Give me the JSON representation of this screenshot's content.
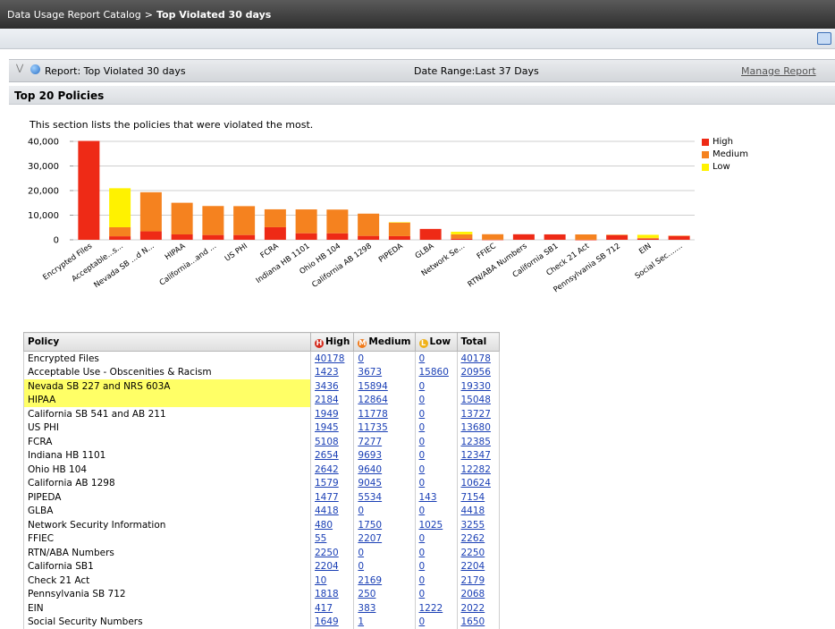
{
  "breadcrumb": {
    "root": "Data Usage Report Catalog",
    "separator": ">",
    "current": "Top Violated 30 days"
  },
  "report_header": {
    "title": "Report: Top Violated 30 days",
    "date_range": "Date Range:Last 37 Days",
    "manage_label": "Manage Report"
  },
  "section": {
    "title": "Top 20 Policies",
    "description": "This section lists the policies that were violated the most."
  },
  "colors": {
    "high": "#ee2a16",
    "medium": "#f5821f",
    "low": "#fff200"
  },
  "chart_data": {
    "type": "bar",
    "stacked": true,
    "categories": [
      "Encrypted Files",
      "Acceptable...s...",
      "Nevada SB ...d N...",
      "HIPAA",
      "California...and ...",
      "US PHI",
      "FCRA",
      "Indiana HB 1101",
      "Ohio HB 104",
      "California AB 1298",
      "PIPEDA",
      "GLBA",
      "Network Se...",
      "FFIEC",
      "RTN/ABA Numbers",
      "California SB1",
      "Check 21 Act",
      "Pennsylvania SB 712",
      "EIN",
      "Social Sec......."
    ],
    "series": [
      {
        "name": "High",
        "color": "#ee2a16",
        "values": [
          40178,
          1423,
          3436,
          2184,
          1949,
          1945,
          5108,
          2654,
          2642,
          1579,
          1477,
          4418,
          480,
          55,
          2250,
          2204,
          10,
          1818,
          417,
          1649
        ]
      },
      {
        "name": "Medium",
        "color": "#f5821f",
        "values": [
          0,
          3673,
          15894,
          12864,
          11778,
          11735,
          7277,
          9693,
          9640,
          9045,
          5534,
          0,
          1750,
          2207,
          0,
          0,
          2169,
          250,
          383,
          1
        ]
      },
      {
        "name": "Low",
        "color": "#fff200",
        "values": [
          0,
          15860,
          0,
          0,
          0,
          0,
          0,
          0,
          0,
          0,
          143,
          0,
          1025,
          0,
          0,
          0,
          0,
          0,
          1222,
          0
        ]
      }
    ],
    "yticks": [
      "40,000",
      "30,000",
      "20,000",
      "10,000",
      "0"
    ],
    "ylim": [
      0,
      40000
    ],
    "legend": "top-right"
  },
  "table": {
    "headers": {
      "policy": "Policy",
      "high": "High",
      "medium": "Medium",
      "low": "Low",
      "total": "Total"
    },
    "icons": {
      "high": "H",
      "medium": "M",
      "low": "L"
    },
    "rows": [
      {
        "policy": "Encrypted Files",
        "high": "40178",
        "medium": "0",
        "low": "0",
        "total": "40178",
        "highlight": false
      },
      {
        "policy": "Acceptable Use - Obscenities & Racism",
        "high": "1423",
        "medium": "3673",
        "low": "15860",
        "total": "20956",
        "highlight": false
      },
      {
        "policy": "Nevada SB 227 and NRS 603A",
        "high": "3436",
        "medium": "15894",
        "low": "0",
        "total": "19330",
        "highlight": true
      },
      {
        "policy": "HIPAA",
        "high": "2184",
        "medium": "12864",
        "low": "0",
        "total": "15048",
        "highlight": true
      },
      {
        "policy": "California SB 541 and AB 211",
        "high": "1949",
        "medium": "11778",
        "low": "0",
        "total": "13727",
        "highlight": false
      },
      {
        "policy": "US PHI",
        "high": "1945",
        "medium": "11735",
        "low": "0",
        "total": "13680",
        "highlight": false
      },
      {
        "policy": "FCRA",
        "high": "5108",
        "medium": "7277",
        "low": "0",
        "total": "12385",
        "highlight": false
      },
      {
        "policy": "Indiana HB 1101",
        "high": "2654",
        "medium": "9693",
        "low": "0",
        "total": "12347",
        "highlight": false
      },
      {
        "policy": "Ohio HB 104",
        "high": "2642",
        "medium": "9640",
        "low": "0",
        "total": "12282",
        "highlight": false
      },
      {
        "policy": "California AB 1298",
        "high": "1579",
        "medium": "9045",
        "low": "0",
        "total": "10624",
        "highlight": false
      },
      {
        "policy": "PIPEDA",
        "high": "1477",
        "medium": "5534",
        "low": "143",
        "total": "7154",
        "highlight": false
      },
      {
        "policy": "GLBA",
        "high": "4418",
        "medium": "0",
        "low": "0",
        "total": "4418",
        "highlight": false
      },
      {
        "policy": "Network Security Information",
        "high": "480",
        "medium": "1750",
        "low": "1025",
        "total": "3255",
        "highlight": false
      },
      {
        "policy": "FFIEC",
        "high": "55",
        "medium": "2207",
        "low": "0",
        "total": "2262",
        "highlight": false
      },
      {
        "policy": "RTN/ABA Numbers",
        "high": "2250",
        "medium": "0",
        "low": "0",
        "total": "2250",
        "highlight": false
      },
      {
        "policy": "California SB1",
        "high": "2204",
        "medium": "0",
        "low": "0",
        "total": "2204",
        "highlight": false
      },
      {
        "policy": "Check 21 Act",
        "high": "10",
        "medium": "2169",
        "low": "0",
        "total": "2179",
        "highlight": false
      },
      {
        "policy": "Pennsylvania SB 712",
        "high": "1818",
        "medium": "250",
        "low": "0",
        "total": "2068",
        "highlight": false
      },
      {
        "policy": "EIN",
        "high": "417",
        "medium": "383",
        "low": "1222",
        "total": "2022",
        "highlight": false
      },
      {
        "policy": "Social Security Numbers",
        "high": "1649",
        "medium": "1",
        "low": "0",
        "total": "1650",
        "highlight": false
      }
    ]
  }
}
